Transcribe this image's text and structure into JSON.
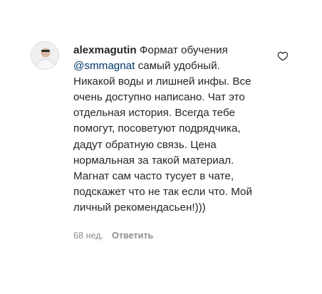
{
  "comment": {
    "username": "alexmagutin",
    "mention": "@smmagnat",
    "text_before_mention": "Формат обучения",
    "text_after_mention": "самый удобный. Никакой воды и лишней инфы. Все очень доступно написано. Чат это отдельная история. Всегда тебе помогут, посоветуют подрядчика, дадут обратную связь. Цена нормальная за такой материал. Магнат сам часто тусует в чате, подскажет что не так если что. Мой личный рекомендасьен!)))",
    "timestamp": "68 нед.",
    "reply_label": "Ответить",
    "like_icon": "heart-outline-icon"
  }
}
